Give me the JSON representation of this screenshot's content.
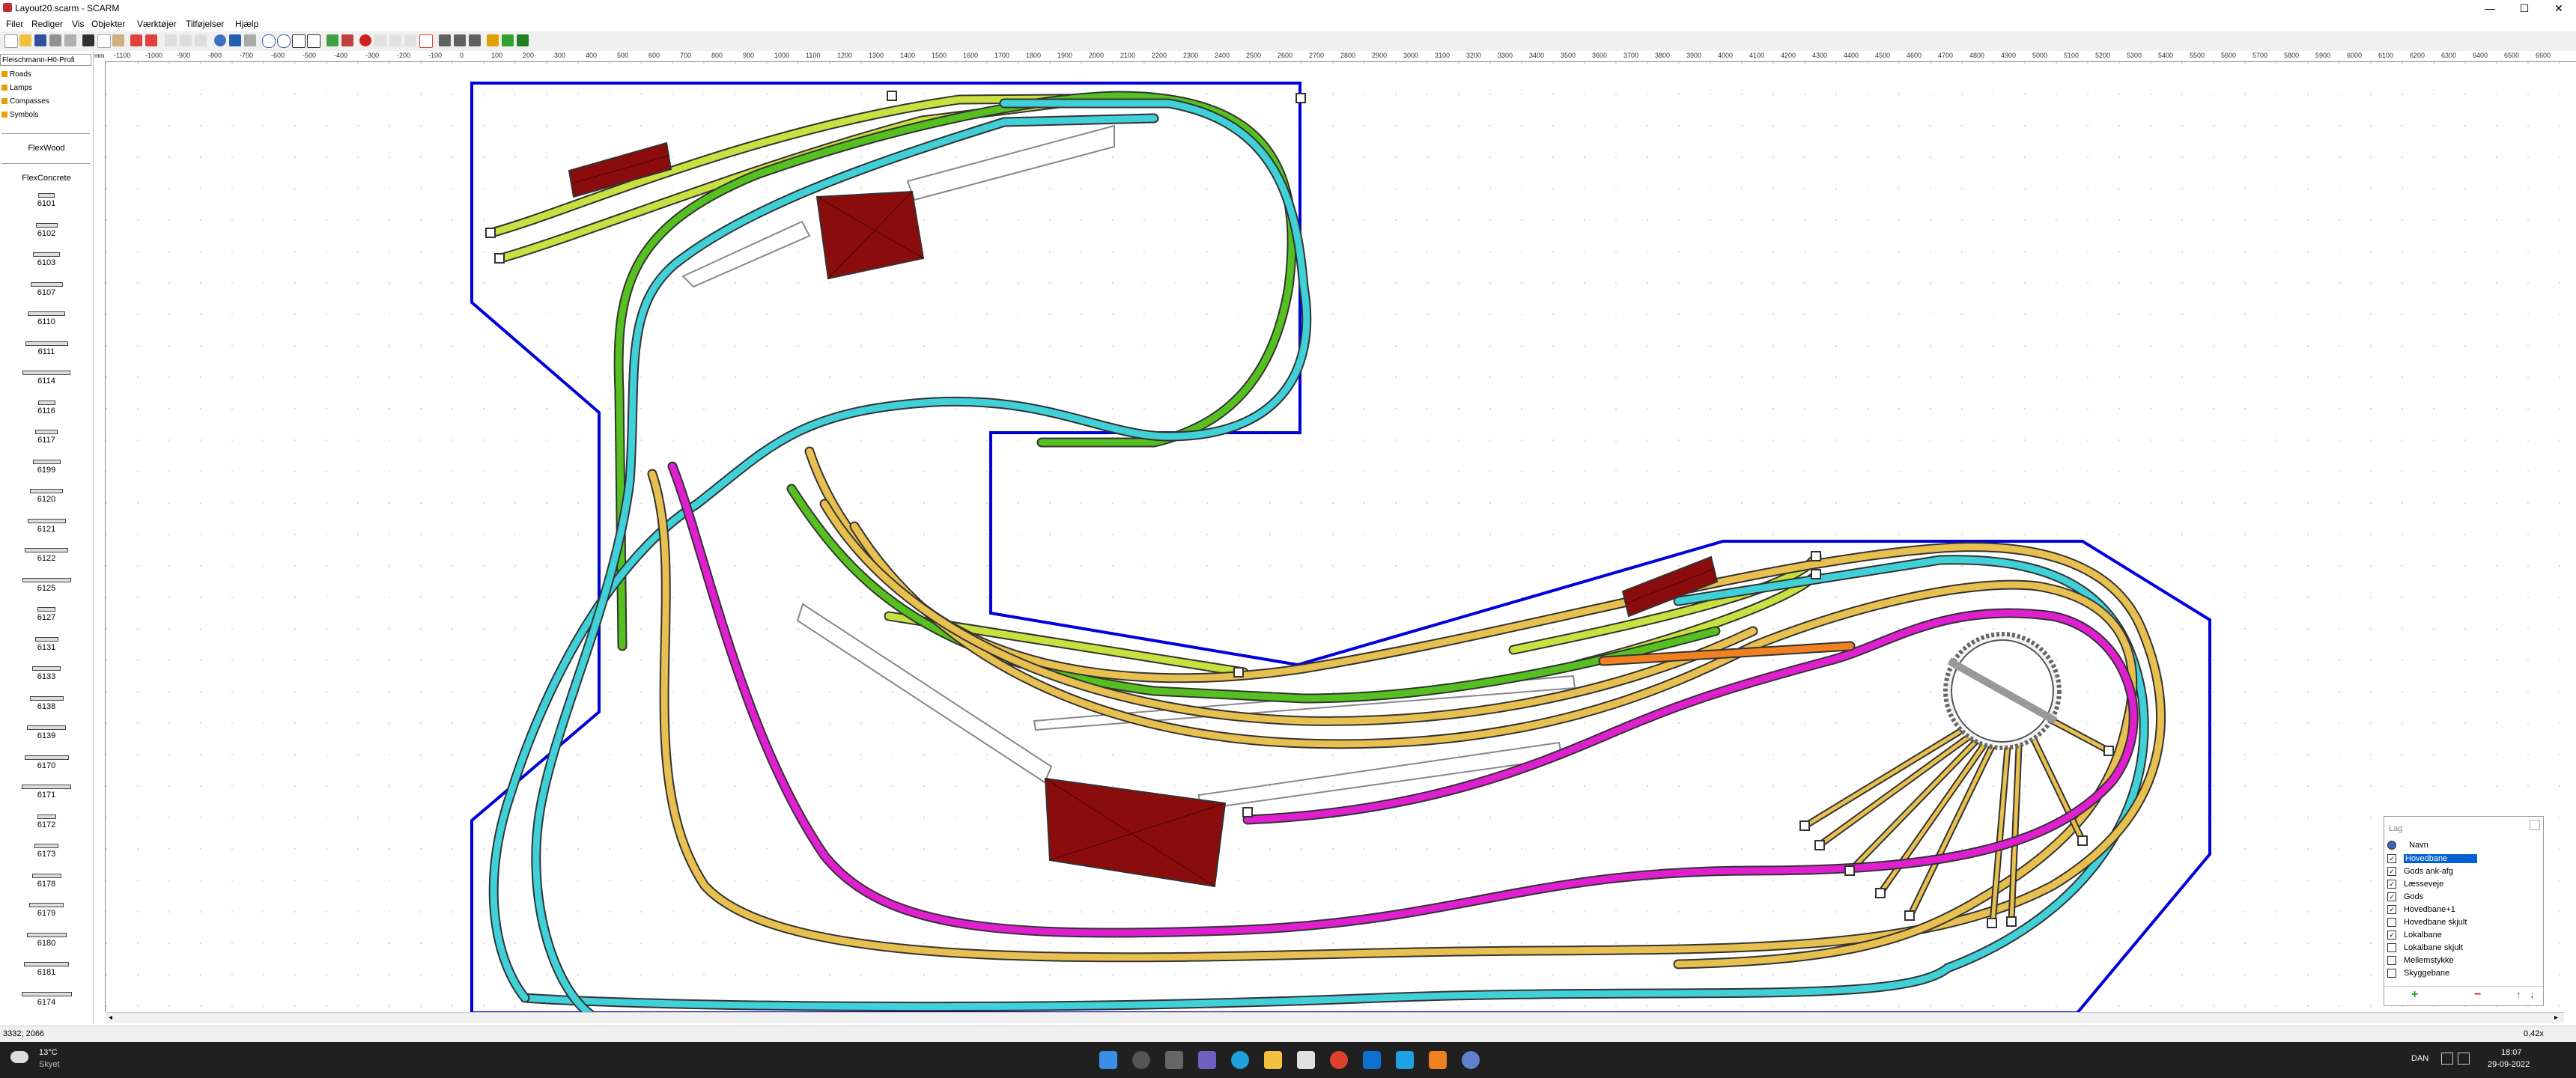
{
  "window": {
    "title": "Layout20.scarm - SCARM",
    "minimize": "—",
    "maximize": "☐",
    "close": "✕"
  },
  "menu": [
    "Filer",
    "Rediger",
    "Vis",
    "Objekter",
    "Værktøjer",
    "Tilføjelser",
    "Hjælp"
  ],
  "sidebar": {
    "library": "Fleischmann-H0-Profi",
    "categories": [
      "Roads",
      "Lamps",
      "Compasses",
      "Symbols"
    ],
    "groups": [
      "FlexWood",
      "FlexConcrete"
    ],
    "parts": [
      "6101",
      "6102",
      "6103",
      "6107",
      "6110",
      "6111",
      "6114",
      "6116",
      "6117",
      "6199",
      "6120",
      "6121",
      "6122",
      "6125",
      "6127",
      "6131",
      "6133",
      "6138",
      "6139",
      "6170",
      "6171",
      "6172",
      "6173",
      "6178",
      "6179",
      "6180",
      "6181",
      "6174"
    ]
  },
  "ruler": {
    "unit": "mm",
    "x_ticks": [
      "-1100",
      "-1000",
      "-900",
      "-800",
      "-700",
      "-600",
      "-500",
      "-400",
      "-300",
      "-200",
      "-100",
      "0",
      "100",
      "200",
      "300",
      "400",
      "500",
      "600",
      "700",
      "800",
      "900",
      "1000",
      "1100",
      "1200",
      "1300",
      "1400",
      "1500",
      "1600",
      "1700",
      "1800",
      "1900",
      "2000",
      "2100",
      "2200",
      "2300",
      "2400",
      "2500",
      "2600",
      "2700",
      "2800",
      "2900",
      "3000",
      "3100",
      "3200",
      "3300",
      "3400",
      "3500",
      "3600",
      "3700",
      "3800",
      "3900",
      "4000",
      "4100",
      "4200",
      "4300",
      "4400",
      "4500",
      "4600",
      "4700",
      "4800",
      "4900",
      "5000",
      "5100",
      "5200",
      "5300",
      "5400",
      "5500",
      "5600",
      "5700",
      "5800",
      "5900",
      "6000",
      "6100",
      "6200",
      "6300",
      "6400",
      "6500",
      "6600"
    ]
  },
  "layers": {
    "title": "Lag",
    "column_name": "Navn",
    "items": [
      {
        "name": "Hovedbane",
        "checked": true,
        "selected": true
      },
      {
        "name": "Gods ank-afg",
        "checked": true
      },
      {
        "name": "Læsseveje",
        "checked": true
      },
      {
        "name": "Gods",
        "checked": true
      },
      {
        "name": "Hovedbane+1",
        "checked": true
      },
      {
        "name": "Hovedbane skjult",
        "checked": false
      },
      {
        "name": "Lokalbane",
        "checked": true
      },
      {
        "name": "Lokalbane skjult",
        "checked": false
      },
      {
        "name": "Mellemstykke",
        "checked": false
      },
      {
        "name": "Skyggebane",
        "checked": false
      }
    ],
    "add": "+",
    "remove": "−",
    "up": "↑",
    "down": "↓"
  },
  "status": {
    "coords": "3332; 2066",
    "zoom": "0,42x"
  },
  "taskbar": {
    "weather_temp": "13°C",
    "weather_desc": "Skyet",
    "language": "DAN",
    "time": "18:07",
    "date": "29-09-2022"
  },
  "colors": {
    "board_outline": "#0000dd",
    "track_green": "#55c020",
    "track_lightgreen": "#c8e040",
    "track_cyan": "#40d0d8",
    "track_yellow": "#e8c050",
    "track_magenta": "#e020d0",
    "track_orange": "#f08020",
    "building": "#8b0c0c",
    "grid_dot": "#d0d0d0"
  }
}
